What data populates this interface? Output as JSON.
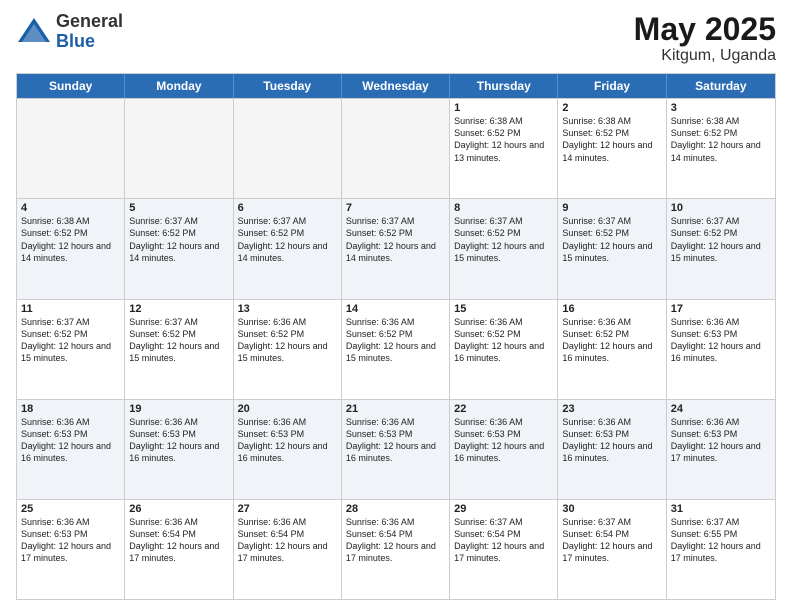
{
  "logo": {
    "general": "General",
    "blue": "Blue"
  },
  "title": {
    "month": "May 2025",
    "location": "Kitgum, Uganda"
  },
  "header_days": [
    "Sunday",
    "Monday",
    "Tuesday",
    "Wednesday",
    "Thursday",
    "Friday",
    "Saturday"
  ],
  "weeks": [
    [
      {
        "day": "",
        "info": "",
        "empty": true
      },
      {
        "day": "",
        "info": "",
        "empty": true
      },
      {
        "day": "",
        "info": "",
        "empty": true
      },
      {
        "day": "",
        "info": "",
        "empty": true
      },
      {
        "day": "1",
        "info": "Sunrise: 6:38 AM\nSunset: 6:52 PM\nDaylight: 12 hours\nand 13 minutes."
      },
      {
        "day": "2",
        "info": "Sunrise: 6:38 AM\nSunset: 6:52 PM\nDaylight: 12 hours\nand 14 minutes."
      },
      {
        "day": "3",
        "info": "Sunrise: 6:38 AM\nSunset: 6:52 PM\nDaylight: 12 hours\nand 14 minutes."
      }
    ],
    [
      {
        "day": "4",
        "info": "Sunrise: 6:38 AM\nSunset: 6:52 PM\nDaylight: 12 hours\nand 14 minutes."
      },
      {
        "day": "5",
        "info": "Sunrise: 6:37 AM\nSunset: 6:52 PM\nDaylight: 12 hours\nand 14 minutes."
      },
      {
        "day": "6",
        "info": "Sunrise: 6:37 AM\nSunset: 6:52 PM\nDaylight: 12 hours\nand 14 minutes."
      },
      {
        "day": "7",
        "info": "Sunrise: 6:37 AM\nSunset: 6:52 PM\nDaylight: 12 hours\nand 14 minutes."
      },
      {
        "day": "8",
        "info": "Sunrise: 6:37 AM\nSunset: 6:52 PM\nDaylight: 12 hours\nand 15 minutes."
      },
      {
        "day": "9",
        "info": "Sunrise: 6:37 AM\nSunset: 6:52 PM\nDaylight: 12 hours\nand 15 minutes."
      },
      {
        "day": "10",
        "info": "Sunrise: 6:37 AM\nSunset: 6:52 PM\nDaylight: 12 hours\nand 15 minutes."
      }
    ],
    [
      {
        "day": "11",
        "info": "Sunrise: 6:37 AM\nSunset: 6:52 PM\nDaylight: 12 hours\nand 15 minutes."
      },
      {
        "day": "12",
        "info": "Sunrise: 6:37 AM\nSunset: 6:52 PM\nDaylight: 12 hours\nand 15 minutes."
      },
      {
        "day": "13",
        "info": "Sunrise: 6:36 AM\nSunset: 6:52 PM\nDaylight: 12 hours\nand 15 minutes."
      },
      {
        "day": "14",
        "info": "Sunrise: 6:36 AM\nSunset: 6:52 PM\nDaylight: 12 hours\nand 15 minutes."
      },
      {
        "day": "15",
        "info": "Sunrise: 6:36 AM\nSunset: 6:52 PM\nDaylight: 12 hours\nand 16 minutes."
      },
      {
        "day": "16",
        "info": "Sunrise: 6:36 AM\nSunset: 6:52 PM\nDaylight: 12 hours\nand 16 minutes."
      },
      {
        "day": "17",
        "info": "Sunrise: 6:36 AM\nSunset: 6:53 PM\nDaylight: 12 hours\nand 16 minutes."
      }
    ],
    [
      {
        "day": "18",
        "info": "Sunrise: 6:36 AM\nSunset: 6:53 PM\nDaylight: 12 hours\nand 16 minutes."
      },
      {
        "day": "19",
        "info": "Sunrise: 6:36 AM\nSunset: 6:53 PM\nDaylight: 12 hours\nand 16 minutes."
      },
      {
        "day": "20",
        "info": "Sunrise: 6:36 AM\nSunset: 6:53 PM\nDaylight: 12 hours\nand 16 minutes."
      },
      {
        "day": "21",
        "info": "Sunrise: 6:36 AM\nSunset: 6:53 PM\nDaylight: 12 hours\nand 16 minutes."
      },
      {
        "day": "22",
        "info": "Sunrise: 6:36 AM\nSunset: 6:53 PM\nDaylight: 12 hours\nand 16 minutes."
      },
      {
        "day": "23",
        "info": "Sunrise: 6:36 AM\nSunset: 6:53 PM\nDaylight: 12 hours\nand 16 minutes."
      },
      {
        "day": "24",
        "info": "Sunrise: 6:36 AM\nSunset: 6:53 PM\nDaylight: 12 hours\nand 17 minutes."
      }
    ],
    [
      {
        "day": "25",
        "info": "Sunrise: 6:36 AM\nSunset: 6:53 PM\nDaylight: 12 hours\nand 17 minutes."
      },
      {
        "day": "26",
        "info": "Sunrise: 6:36 AM\nSunset: 6:54 PM\nDaylight: 12 hours\nand 17 minutes."
      },
      {
        "day": "27",
        "info": "Sunrise: 6:36 AM\nSunset: 6:54 PM\nDaylight: 12 hours\nand 17 minutes."
      },
      {
        "day": "28",
        "info": "Sunrise: 6:36 AM\nSunset: 6:54 PM\nDaylight: 12 hours\nand 17 minutes."
      },
      {
        "day": "29",
        "info": "Sunrise: 6:37 AM\nSunset: 6:54 PM\nDaylight: 12 hours\nand 17 minutes."
      },
      {
        "day": "30",
        "info": "Sunrise: 6:37 AM\nSunset: 6:54 PM\nDaylight: 12 hours\nand 17 minutes."
      },
      {
        "day": "31",
        "info": "Sunrise: 6:37 AM\nSunset: 6:55 PM\nDaylight: 12 hours\nand 17 minutes."
      }
    ]
  ]
}
